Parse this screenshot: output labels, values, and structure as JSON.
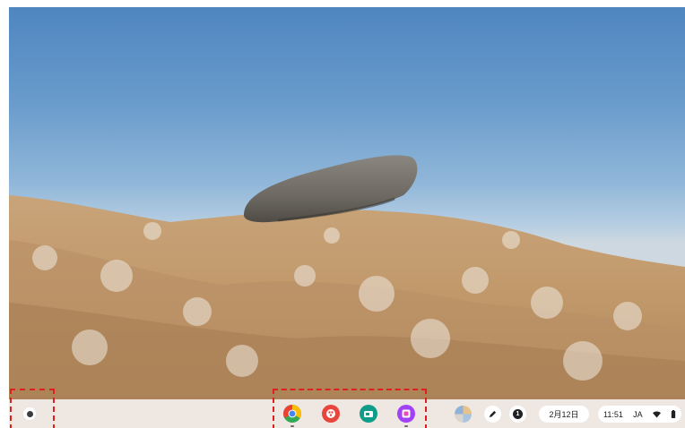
{
  "shelf": {
    "launcher_icon": "launcher-icon",
    "pinned_apps": [
      {
        "name": "chrome",
        "icon": "chrome-icon",
        "color": "#ea4335"
      },
      {
        "name": "app-2",
        "icon": "red-app-icon",
        "color": "#e8453c"
      },
      {
        "name": "app-3",
        "icon": "teal-app-icon",
        "color": "#1a73e8"
      },
      {
        "name": "app-4",
        "icon": "purple-app-icon",
        "color": "#a142f4"
      }
    ]
  },
  "status_tray": {
    "date": "2月12日",
    "time": "11:51",
    "ime": "JA",
    "wifi_icon": "wifi-icon",
    "battery_icon": "battery-icon",
    "stylus_icon": "stylus-icon",
    "notification_count": "1"
  },
  "annotations": {
    "highlight_color": "#e0201f"
  }
}
